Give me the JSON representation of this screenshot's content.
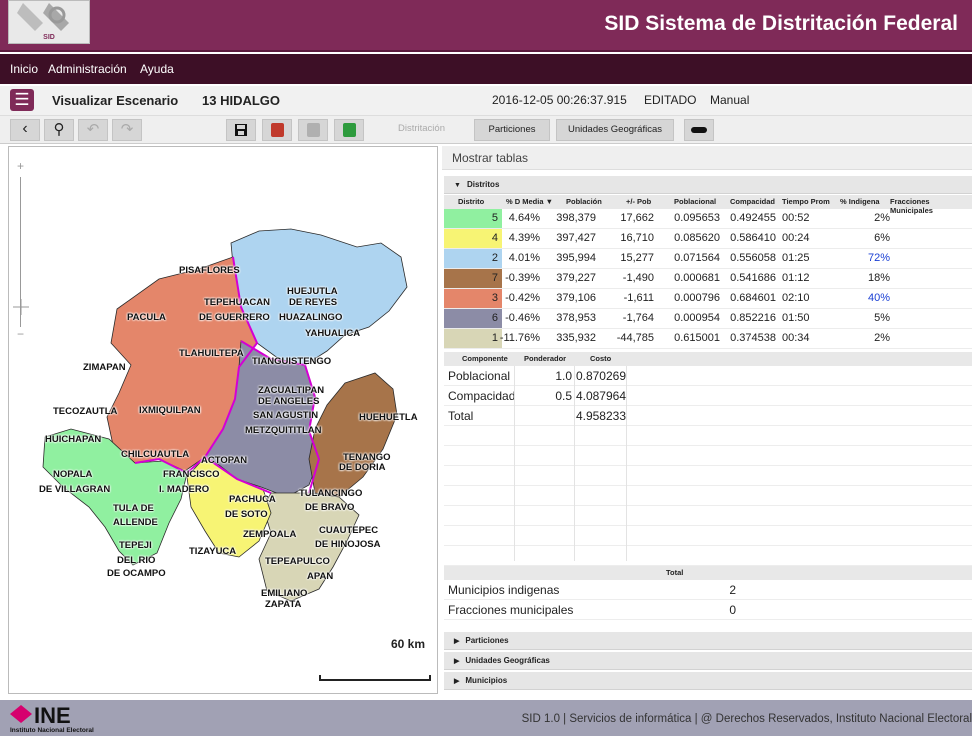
{
  "header": {
    "app_title": "SID Sistema de Distritación Federal",
    "logo_text": "SID"
  },
  "menu": [
    "Inicio",
    "Administración",
    "Ayuda"
  ],
  "scenario": {
    "title": "Visualizar Escenario",
    "state": "13 HIDALGO",
    "timestamp": "2016-12-05 00:26:37.915",
    "status": "EDITADO",
    "mode": "Manual"
  },
  "toolbar": {
    "back": "‹",
    "locate": "⚲",
    "undo": "↶",
    "redo": "↷",
    "distritacion": "Distritación",
    "particiones": "Particiones",
    "unidades": "Unidades Geográficas"
  },
  "map": {
    "zoom_in": "+",
    "zoom_out": "−",
    "scale_label": "60 km",
    "labels": [
      "PISAFLORES",
      "HUEJUTLA",
      "TEPEHUACAN",
      "DE REYES",
      "PACULA",
      "DE GUERRERO",
      "HUAZALINGO",
      "YAHUALICA",
      "TLAHUILTEPA",
      "ZIMAPAN",
      "TIANGUISTENGO",
      "ZACUALTIPAN",
      "DE ANGELES",
      "TECOZAUTLA",
      "IXMIQUILPAN",
      "SAN AGUSTIN",
      "METZQUITITLAN",
      "HUEHUETLA",
      "HUICHAPAN",
      "CHILCUAUTLA",
      "ACTOPAN",
      "TENANGO",
      "NOPALA",
      "FRANCISCO",
      "DE DORIA",
      "DE VILLAGRAN",
      "I. MADERO",
      "PACHUCA",
      "TULANCINGO",
      "DE SOTO",
      "DE BRAVO",
      "TULA DE",
      "ALLENDE",
      "ZEMPOALA",
      "CUAUTEPEC",
      "TEPEJI",
      "DE HINOJOSA",
      "TIZAYUCA",
      "TEPEAPULCO",
      "DEL RIO",
      "DE OCAMPO",
      "APAN",
      "EMILIANO",
      "ZAPATA"
    ]
  },
  "tables": {
    "show_label": "Mostrar tablas",
    "distritos_title": "Distritos",
    "distritos_headers": [
      "Distrito",
      "% D Media ▼",
      "Población",
      "+/- Pob",
      "Poblacional",
      "Compacidad",
      "Tiempo Prom",
      "% Indigena",
      "Fracciones Municipales"
    ],
    "distritos_rows": [
      {
        "distrito": "5",
        "media": "4.64%",
        "poblacion": "398,379",
        "pob": "17,662",
        "poblacional": "0.095653",
        "compacidad": "0.492455",
        "tiempo": "00:52",
        "indigena": "2%",
        "color": "#90f0a0",
        "highlight": false
      },
      {
        "distrito": "4",
        "media": "4.39%",
        "poblacion": "397,427",
        "pob": "16,710",
        "poblacional": "0.085620",
        "compacidad": "0.586410",
        "tiempo": "00:24",
        "indigena": "6%",
        "color": "#f7f474",
        "highlight": false
      },
      {
        "distrito": "2",
        "media": "4.01%",
        "poblacion": "395,994",
        "pob": "15,277",
        "poblacional": "0.071564",
        "compacidad": "0.556058",
        "tiempo": "01:25",
        "indigena": "72%",
        "color": "#aed4f0",
        "highlight": true
      },
      {
        "distrito": "7",
        "media": "-0.39%",
        "poblacion": "379,227",
        "pob": "-1,490",
        "poblacional": "0.000681",
        "compacidad": "0.541686",
        "tiempo": "01:12",
        "indigena": "18%",
        "color": "#a7744a",
        "highlight": false
      },
      {
        "distrito": "3",
        "media": "-0.42%",
        "poblacion": "379,106",
        "pob": "-1,611",
        "poblacional": "0.000796",
        "compacidad": "0.684601",
        "tiempo": "02:10",
        "indigena": "40%",
        "color": "#e4866a",
        "highlight": true
      },
      {
        "distrito": "6",
        "media": "-0.46%",
        "poblacion": "378,953",
        "pob": "-1,764",
        "poblacional": "0.000954",
        "compacidad": "0.852216",
        "tiempo": "01:50",
        "indigena": "5%",
        "color": "#8c8ca6",
        "highlight": false
      },
      {
        "distrito": "1",
        "media": "-11.76%",
        "poblacion": "335,932",
        "pob": "-44,785",
        "poblacional": "0.615001",
        "compacidad": "0.374538",
        "tiempo": "00:34",
        "indigena": "2%",
        "color": "#d8d6b6",
        "highlight": false
      }
    ],
    "componentes_headers": [
      "Componente",
      "Ponderador",
      "Costo"
    ],
    "componentes_rows": [
      {
        "componente": "Poblacional",
        "ponderador": "1.0",
        "costo": "0.870269"
      },
      {
        "componente": "Compacidad",
        "ponderador": "0.5",
        "costo": "4.087964"
      },
      {
        "componente": "Total",
        "ponderador": "",
        "costo": "4.958233"
      }
    ],
    "totales_header": "Total",
    "totales_rows": [
      {
        "label": "Municipios indigenas",
        "value": "2"
      },
      {
        "label": "Fracciones municipales",
        "value": "0"
      }
    ],
    "collapsed_sections": [
      "Particiones",
      "Unidades Geográficas",
      "Municipios"
    ]
  },
  "footer": {
    "logo_text": "INE",
    "logo_subtext": "Instituto Nacional Electoral",
    "text": "SID 1.0 | Servicios de informática | @ Derechos Reservados, Instituto Nacional Electoral"
  }
}
